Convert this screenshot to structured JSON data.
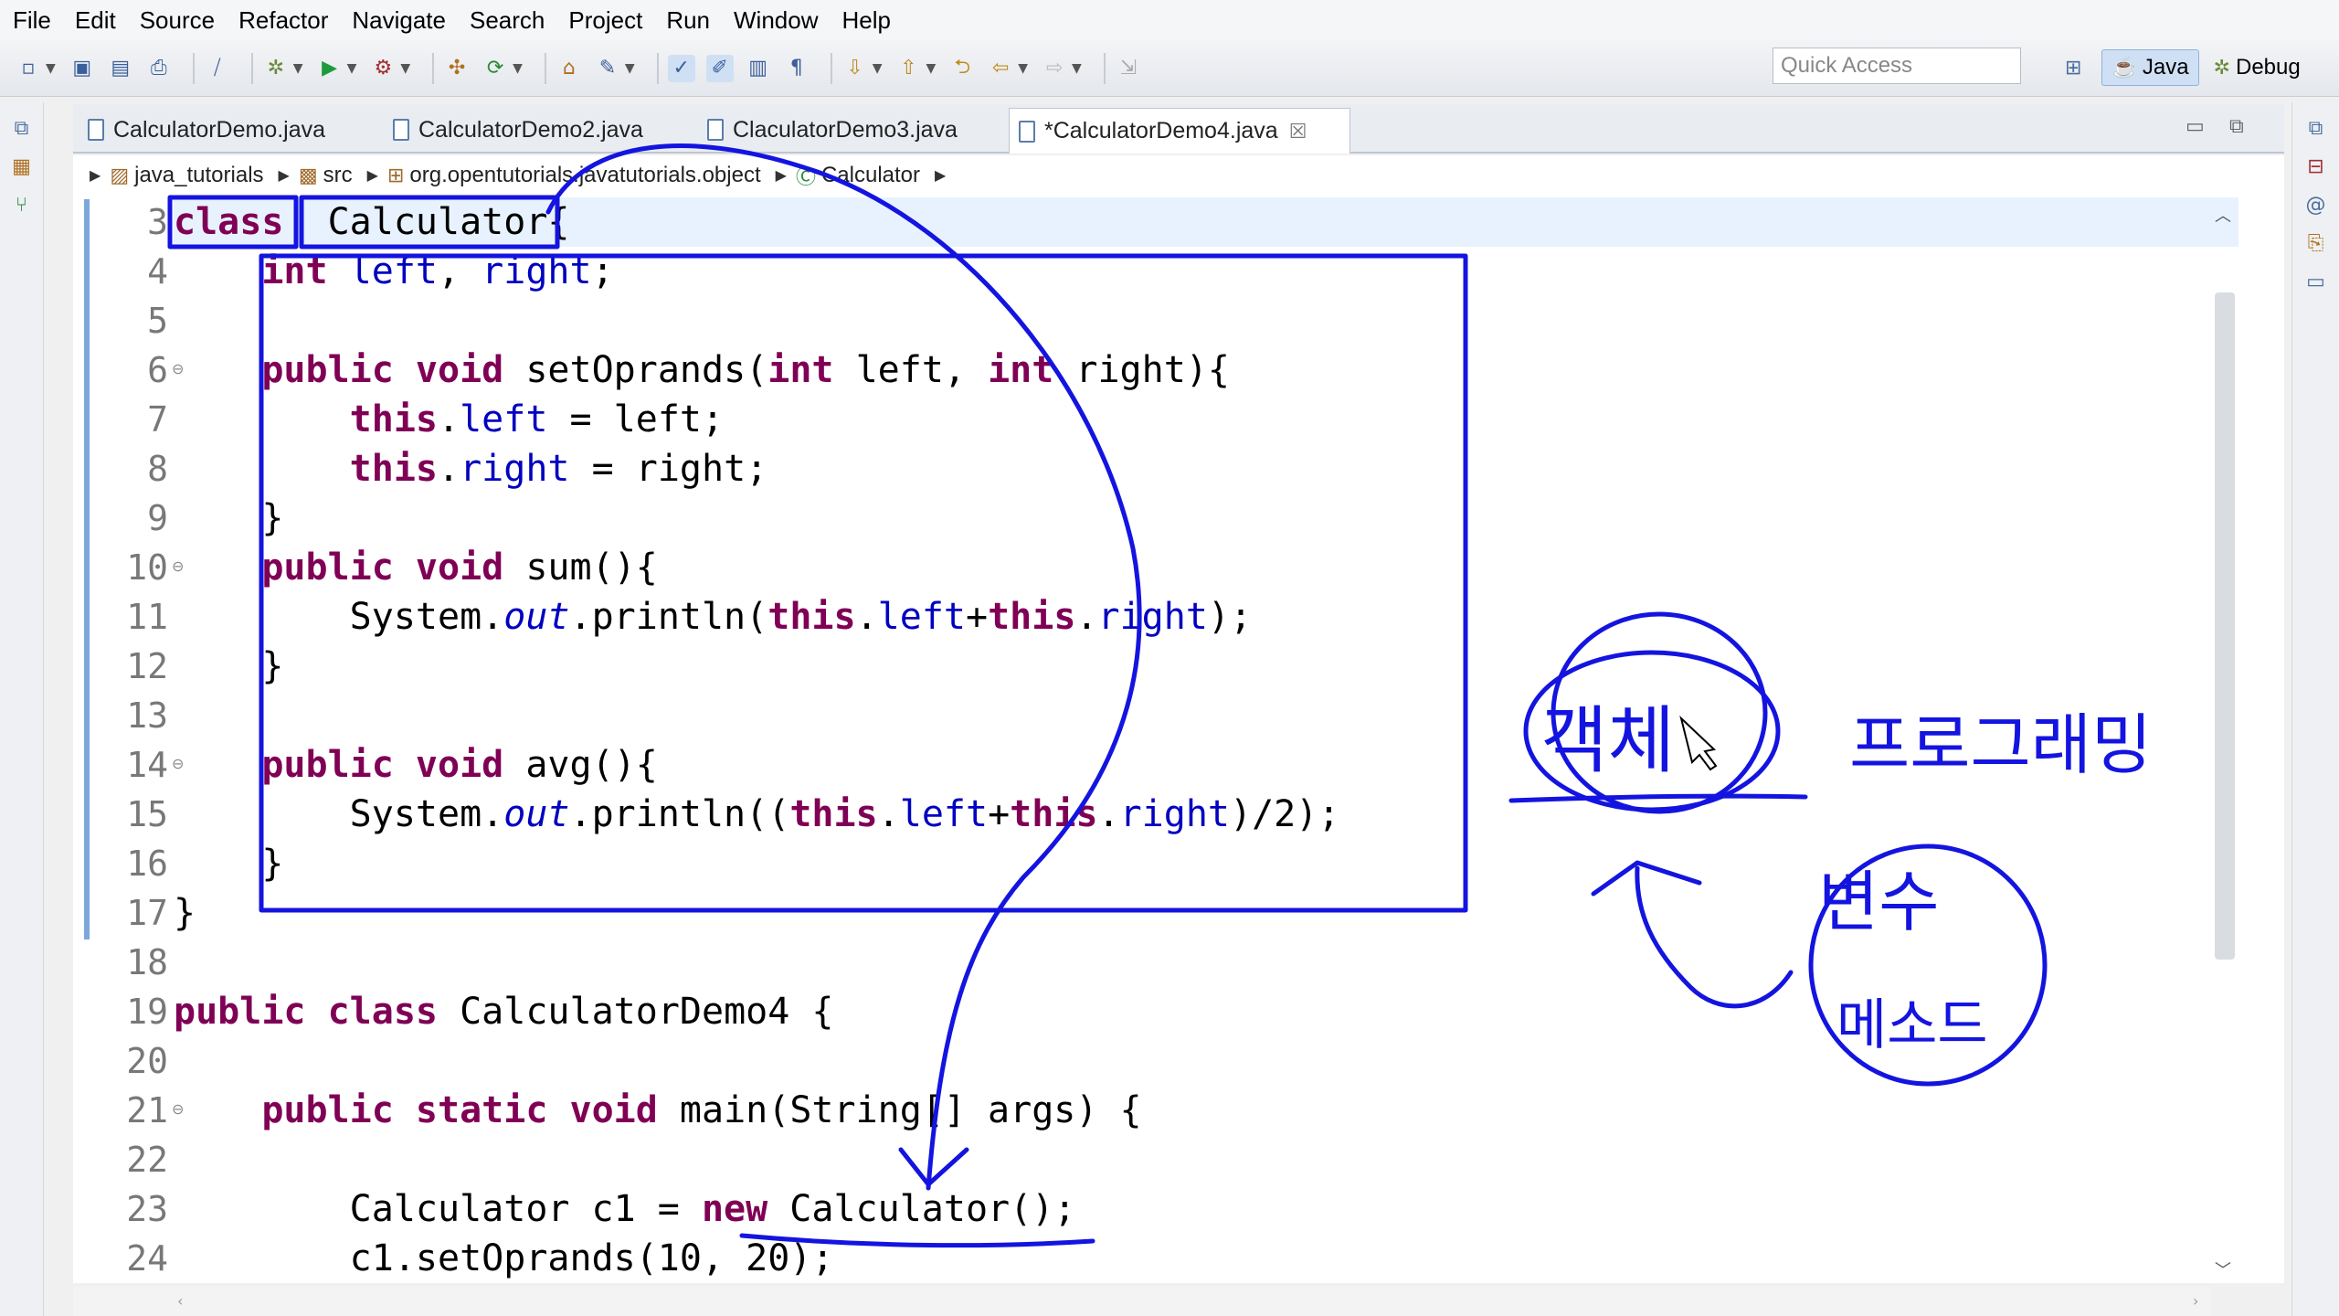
{
  "menu": [
    "File",
    "Edit",
    "Source",
    "Refactor",
    "Navigate",
    "Search",
    "Project",
    "Run",
    "Window",
    "Help"
  ],
  "toolbar": {
    "quick_access_placeholder": "Quick Access",
    "perspectives": [
      {
        "label": "Java",
        "icon": "java-perspective-icon",
        "active": true
      },
      {
        "label": "Debug",
        "icon": "debug-perspective-icon",
        "active": false
      }
    ]
  },
  "tabs": [
    {
      "label": "CalculatorDemo.java",
      "active": false
    },
    {
      "label": "CalculatorDemo2.java",
      "active": false
    },
    {
      "label": "ClaculatorDemo3.java",
      "active": false
    },
    {
      "label": "*CalculatorDemo4.java",
      "active": true
    }
  ],
  "breadcrumb": [
    {
      "label": "java_tutorials",
      "icon": "project-icon"
    },
    {
      "label": "src",
      "icon": "source-folder-icon"
    },
    {
      "label": "org.opentutorials.javatutorials.object",
      "icon": "package-icon"
    },
    {
      "label": "Calculator",
      "icon": "class-icon"
    }
  ],
  "code": [
    {
      "n": "3",
      "fold": false,
      "current": true,
      "tokens": [
        [
          "kw",
          "class"
        ],
        [
          "",
          "  Calculator{"
        ]
      ]
    },
    {
      "n": "4",
      "fold": false,
      "tokens": [
        [
          "",
          "    "
        ],
        [
          "kw",
          "int"
        ],
        [
          "",
          ""
        ],
        [
          "fld",
          " left"
        ],
        [
          "",
          ", "
        ],
        [
          "fld",
          "right"
        ],
        [
          "",
          ";"
        ]
      ]
    },
    {
      "n": "5",
      "fold": false,
      "tokens": []
    },
    {
      "n": "6",
      "fold": true,
      "tokens": [
        [
          "",
          "    "
        ],
        [
          "kw",
          "public"
        ],
        [
          "",
          ""
        ],
        [
          "kw",
          " void"
        ],
        [
          "",
          " setOprands("
        ],
        [
          "kw",
          "int"
        ],
        [
          "",
          " left, "
        ],
        [
          "kw",
          "int"
        ],
        [
          "",
          " right){"
        ]
      ]
    },
    {
      "n": "7",
      "fold": false,
      "tokens": [
        [
          "",
          "        "
        ],
        [
          "kw",
          "this"
        ],
        [
          "",
          "."
        ],
        [
          "fld",
          "left"
        ],
        [
          "",
          " = left;"
        ]
      ]
    },
    {
      "n": "8",
      "fold": false,
      "tokens": [
        [
          "",
          "        "
        ],
        [
          "kw",
          "this"
        ],
        [
          "",
          "."
        ],
        [
          "fld",
          "right"
        ],
        [
          "",
          " = right;"
        ]
      ]
    },
    {
      "n": "9",
      "fold": false,
      "tokens": [
        [
          "",
          "    }"
        ]
      ]
    },
    {
      "n": "10",
      "fold": true,
      "tokens": [
        [
          "",
          "    "
        ],
        [
          "kw",
          "public"
        ],
        [
          "kw",
          " void"
        ],
        [
          "",
          " sum(){"
        ]
      ]
    },
    {
      "n": "11",
      "fold": false,
      "tokens": [
        [
          "",
          "        System."
        ],
        [
          "st",
          "out"
        ],
        [
          "",
          ".println("
        ],
        [
          "kw",
          "this"
        ],
        [
          "",
          "."
        ],
        [
          "fld",
          "left"
        ],
        [
          "",
          "+"
        ],
        [
          "kw",
          "this"
        ],
        [
          "",
          "."
        ],
        [
          "fld",
          "right"
        ],
        [
          "",
          ");"
        ]
      ]
    },
    {
      "n": "12",
      "fold": false,
      "tokens": [
        [
          "",
          "    }"
        ]
      ]
    },
    {
      "n": "13",
      "fold": false,
      "tokens": []
    },
    {
      "n": "14",
      "fold": true,
      "tokens": [
        [
          "",
          "    "
        ],
        [
          "kw",
          "public"
        ],
        [
          "kw",
          " void"
        ],
        [
          "",
          " avg(){"
        ]
      ]
    },
    {
      "n": "15",
      "fold": false,
      "tokens": [
        [
          "",
          "        System."
        ],
        [
          "st",
          "out"
        ],
        [
          "",
          ".println(("
        ],
        [
          "kw",
          "this"
        ],
        [
          "",
          "."
        ],
        [
          "fld",
          "left"
        ],
        [
          "",
          "+"
        ],
        [
          "kw",
          "this"
        ],
        [
          "",
          "."
        ],
        [
          "fld",
          "right"
        ],
        [
          "",
          ")/2);"
        ]
      ]
    },
    {
      "n": "16",
      "fold": false,
      "tokens": [
        [
          "",
          "    }"
        ]
      ]
    },
    {
      "n": "17",
      "fold": false,
      "tokens": [
        [
          "",
          "}"
        ]
      ]
    },
    {
      "n": "18",
      "fold": false,
      "tokens": []
    },
    {
      "n": "19",
      "fold": false,
      "tokens": [
        [
          "kw",
          "public"
        ],
        [
          "kw",
          " class"
        ],
        [
          "",
          " CalculatorDemo4 {"
        ]
      ]
    },
    {
      "n": "20",
      "fold": false,
      "tokens": []
    },
    {
      "n": "21",
      "fold": true,
      "tokens": [
        [
          "",
          "    "
        ],
        [
          "kw",
          "public"
        ],
        [
          "kw",
          " static"
        ],
        [
          "kw",
          " void"
        ],
        [
          "",
          " main(String[] args) {"
        ]
      ]
    },
    {
      "n": "22",
      "fold": false,
      "tokens": []
    },
    {
      "n": "23",
      "fold": false,
      "tokens": [
        [
          "",
          "        Calculator c1 = "
        ],
        [
          "kw",
          "new"
        ],
        [
          "",
          " Calculator();"
        ]
      ]
    },
    {
      "n": "24",
      "fold": false,
      "tokens": [
        [
          "",
          "        c1.setOprands(10, 20);"
        ]
      ]
    }
  ],
  "handwriting": {
    "circled_word": "객체",
    "side_word": "프로그래밍",
    "inner_word_top": "변수",
    "inner_word_bottom": "메소드"
  },
  "colors": {
    "annotation_blue": "#1414e0",
    "keyword": "#7f0055",
    "field": "#0000c0"
  }
}
